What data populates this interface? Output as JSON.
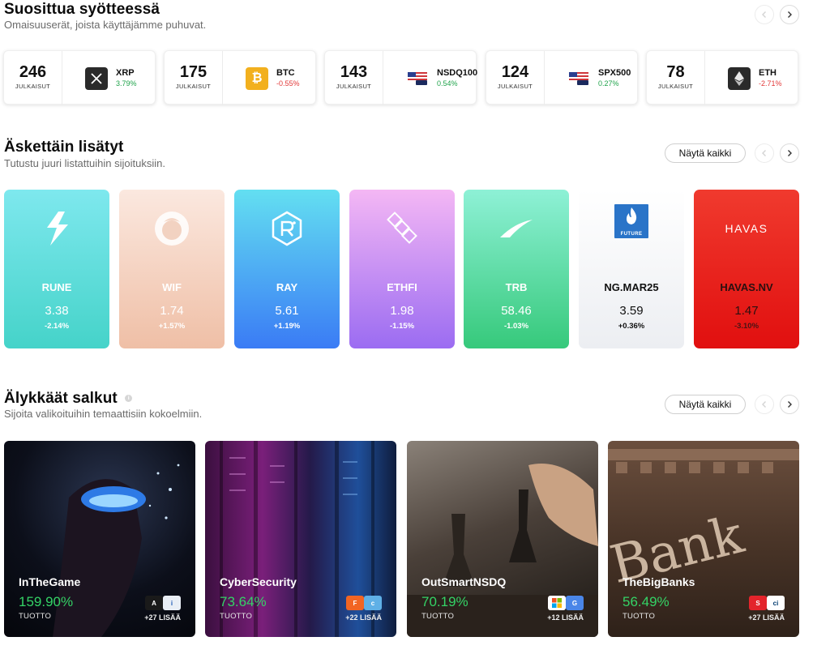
{
  "popular": {
    "title": "Suosittua syötteessä",
    "subtitle": "Omaisuuserät, joista käyttäjämme puhuvat.",
    "posts_label": "JULKAISUT",
    "items": [
      {
        "count": "246",
        "symbol": "XRP",
        "change": "3.79%",
        "icon": "xrp-icon",
        "color": "#2a2a2a"
      },
      {
        "count": "175",
        "symbol": "BTC",
        "change": "-0.55%",
        "icon": "btc-icon",
        "color": "#f2b01e"
      },
      {
        "count": "143",
        "symbol": "NSDQ100",
        "change": "0.54%",
        "icon": "us-flag-icon",
        "color": "#ffffff"
      },
      {
        "count": "124",
        "symbol": "SPX500",
        "change": "0.27%",
        "icon": "us-flag-icon",
        "color": "#ffffff"
      },
      {
        "count": "78",
        "symbol": "ETH",
        "change": "-2.71%",
        "icon": "eth-icon",
        "color": "#2a2a2a"
      }
    ]
  },
  "recent": {
    "title": "Äskettäin lisätyt",
    "subtitle": "Tutustu juuri listattuihin sijoituksiin.",
    "show_all": "Näytä kaikki",
    "items": [
      {
        "name": "RUNE",
        "price": "3.38",
        "change": "-2.14%",
        "logo": "rune-bolt-icon"
      },
      {
        "name": "WIF",
        "price": "1.74",
        "change": "+1.57%",
        "logo": "wif-dog-icon"
      },
      {
        "name": "RAY",
        "price": "5.61",
        "change": "+1.19%",
        "logo": "ray-hexagon-icon"
      },
      {
        "name": "ETHFI",
        "price": "1.98",
        "change": "-1.15%",
        "logo": "ethfi-chain-icon"
      },
      {
        "name": "TRB",
        "price": "58.46",
        "change": "-1.03%",
        "logo": "trb-swoosh-icon"
      },
      {
        "name": "NG.MAR25",
        "price": "3.59",
        "change": "+0.36%",
        "logo": "flame-future-icon",
        "logo_text": "FUTURE"
      },
      {
        "name": "HAVAS.NV",
        "price": "1.47",
        "change": "-3.10%",
        "logo": "havas-logo",
        "logo_text": "HAVAS"
      }
    ]
  },
  "smart": {
    "title": "Älykkäät salkut",
    "subtitle": "Sijoita valikoituihin temaattisiin kokoelmiin.",
    "show_all": "Näytä kaikki",
    "return_label": "TUOTTO",
    "items": [
      {
        "name": "InTheGame",
        "return": "159.90%",
        "more": "+27 LISÄÄ"
      },
      {
        "name": "CyberSecurity",
        "return": "73.64%",
        "more": "+22 LISÄÄ"
      },
      {
        "name": "OutSmartNSDQ",
        "return": "70.19%",
        "more": "+12 LISÄÄ"
      },
      {
        "name": "TheBigBanks",
        "return": "56.49%",
        "more": "+27 LISÄÄ"
      }
    ]
  }
}
